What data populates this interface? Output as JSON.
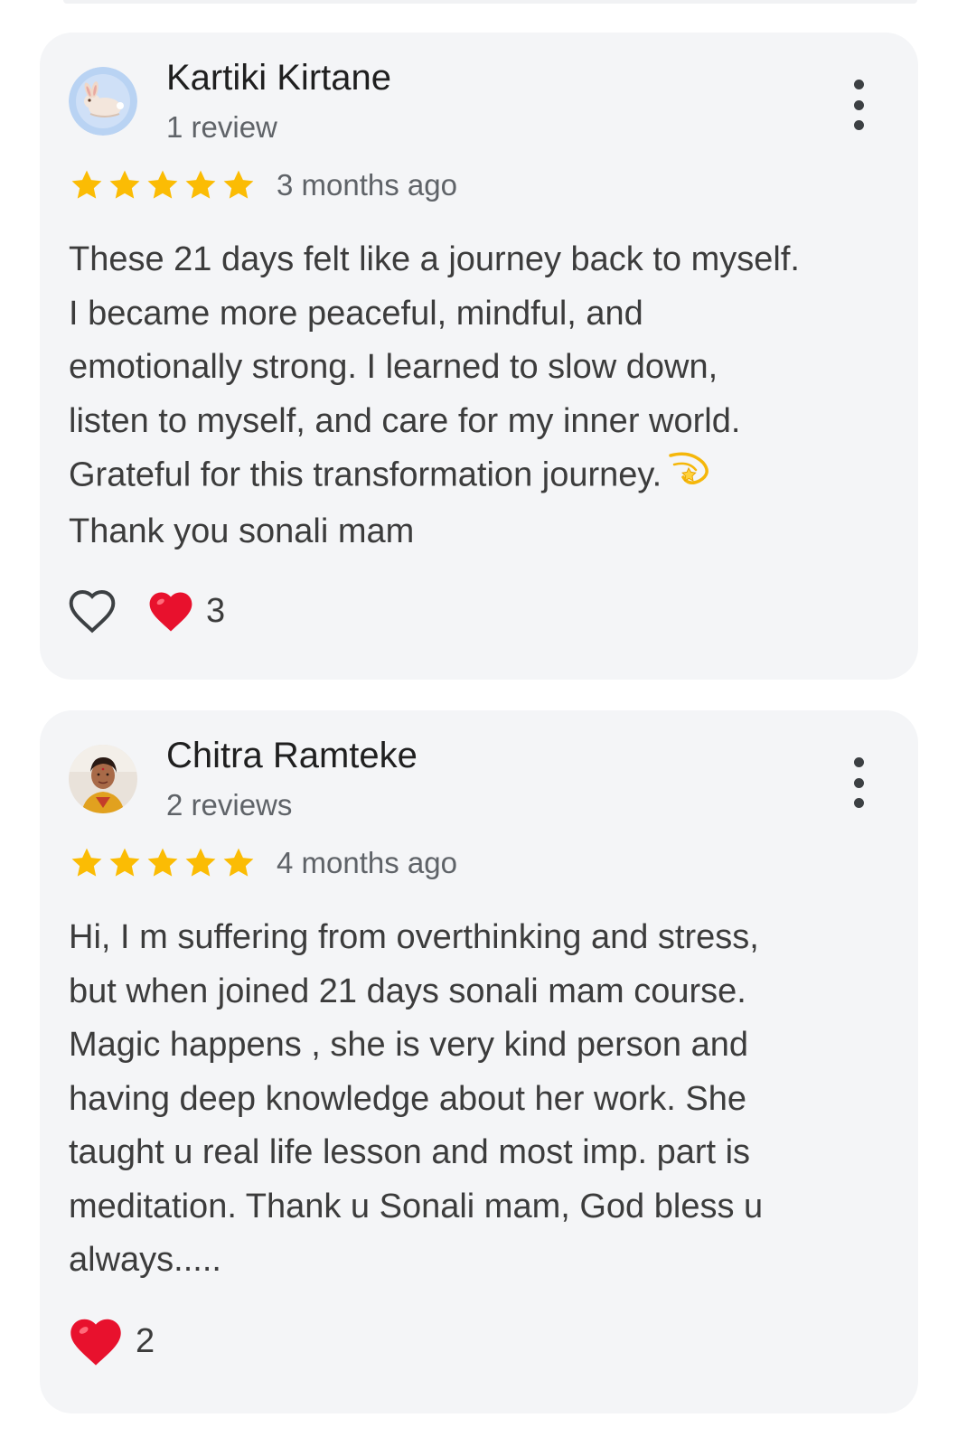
{
  "reviews": [
    {
      "reviewer_name": "Kartiki Kirtane",
      "review_count": "1 review",
      "rating": 5,
      "time_ago": "3 months ago",
      "text_lines": [
        "These 21 days felt like a journey back to myself.",
        "I became more peaceful, mindful, and",
        "emotionally strong. I learned to slow down,",
        "listen to myself, and care for my inner world.",
        "Grateful for this transformation journey.",
        "Thank you sonali mam"
      ],
      "avatar_icon": "rabbit-illustration-avatar",
      "show_like_button": true,
      "reaction_icon": "red-heart-icon",
      "reaction_count": "3"
    },
    {
      "reviewer_name": "Chitra Ramteke",
      "review_count": "2 reviews",
      "rating": 5,
      "time_ago": "4 months ago",
      "text_lines": [
        "Hi, I m suffering from overthinking and stress,",
        "but when joined 21 days sonali mam course.",
        "Magic happens , she is very kind person and",
        "having deep knowledge about her work. She",
        "taught u real life lesson and most imp. part is",
        "meditation. Thank u Sonali mam, God bless u",
        "always....."
      ],
      "avatar_icon": "photo-avatar",
      "show_like_button": false,
      "reaction_icon": "red-heart-icon",
      "reaction_count": "2"
    }
  ],
  "colors": {
    "card_background": "#f4f5f7",
    "star": "#fbbc04",
    "heart": "#e8112d",
    "secondary_text": "#5f6368"
  },
  "icons": {
    "star": "star-icon",
    "more": "more-vert-icon",
    "like": "heart-outline-icon",
    "emoji": "dizzy-star-emoji"
  }
}
